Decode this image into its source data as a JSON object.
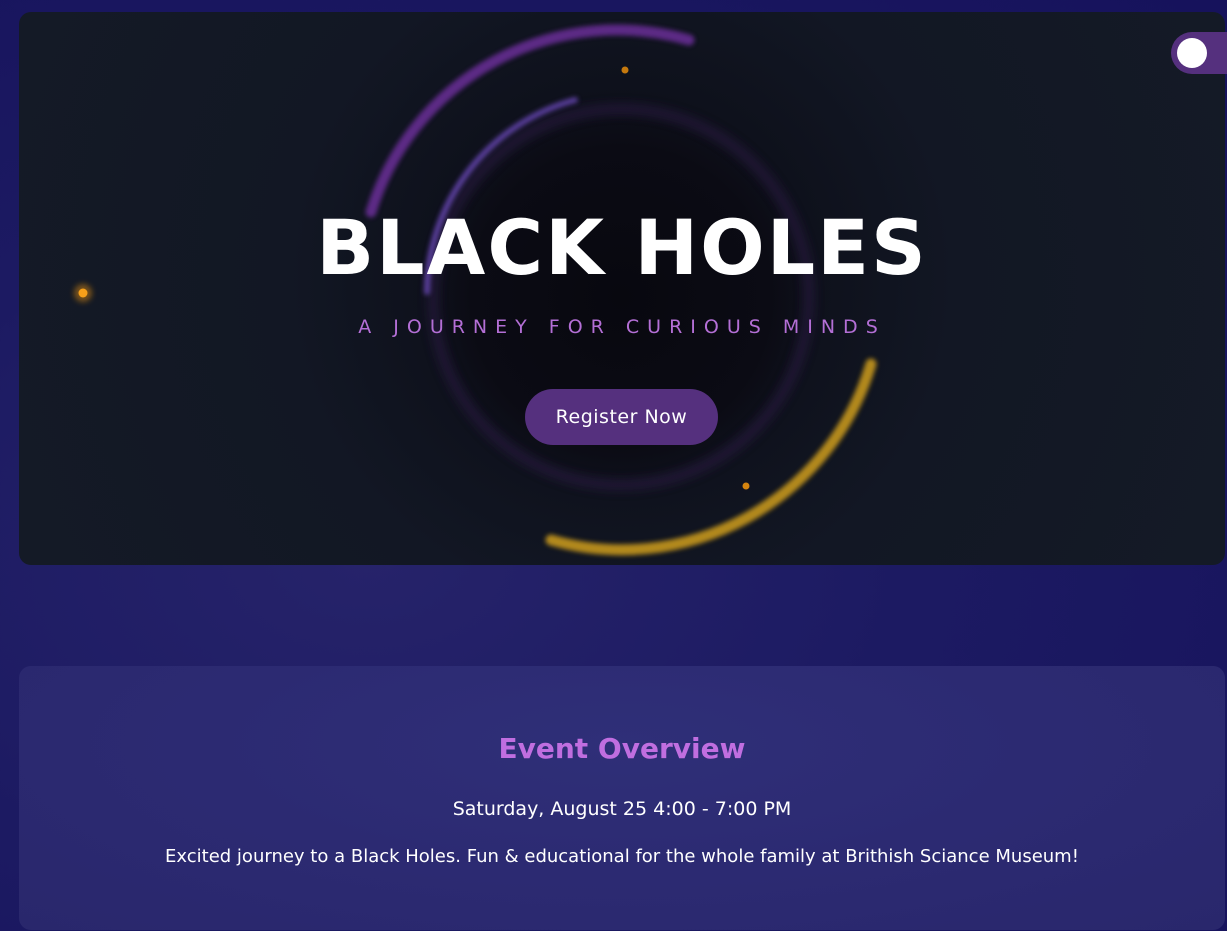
{
  "hero": {
    "title": "BLACK HOLES",
    "subtitle": "A JOURNEY FOR CURIOUS MINDS",
    "register_label": "Register Now"
  },
  "overview": {
    "title": "Event Overview",
    "date": "Saturday, August 25 4:00 - 7:00 PM",
    "description": "Excited journey to a Black Holes. Fun & educational for the whole family at Brithish Sciance Museum!"
  },
  "theme_toggle": {
    "state": "on"
  },
  "colors": {
    "page_background": "#1c1a62",
    "hero_background": "#121724",
    "accent_purple": "#55307e",
    "subtitle_purple": "#b46fd6",
    "overview_title": "#c06ee0",
    "ring_gold": "#d4a21a",
    "star_orange": "#f59a0b"
  }
}
